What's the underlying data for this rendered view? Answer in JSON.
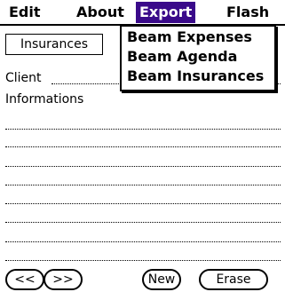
{
  "menubar": {
    "items": [
      {
        "label": "Edit"
      },
      {
        "label": "About"
      },
      {
        "label": "Export"
      },
      {
        "label": "Flash"
      }
    ],
    "active_index": 2,
    "active_color": "#3a0a8a"
  },
  "dropdown": {
    "items": [
      {
        "label": "Beam Expenses"
      },
      {
        "label": "Beam Agenda"
      },
      {
        "label": "Beam Insurances"
      }
    ]
  },
  "form": {
    "category": "Insurances",
    "client_label": "Client",
    "client_value": "",
    "info_label": "Informations",
    "info_value": ""
  },
  "buttons": {
    "prev": "<<",
    "next": ">>",
    "new": "New",
    "erase": "Erase"
  }
}
